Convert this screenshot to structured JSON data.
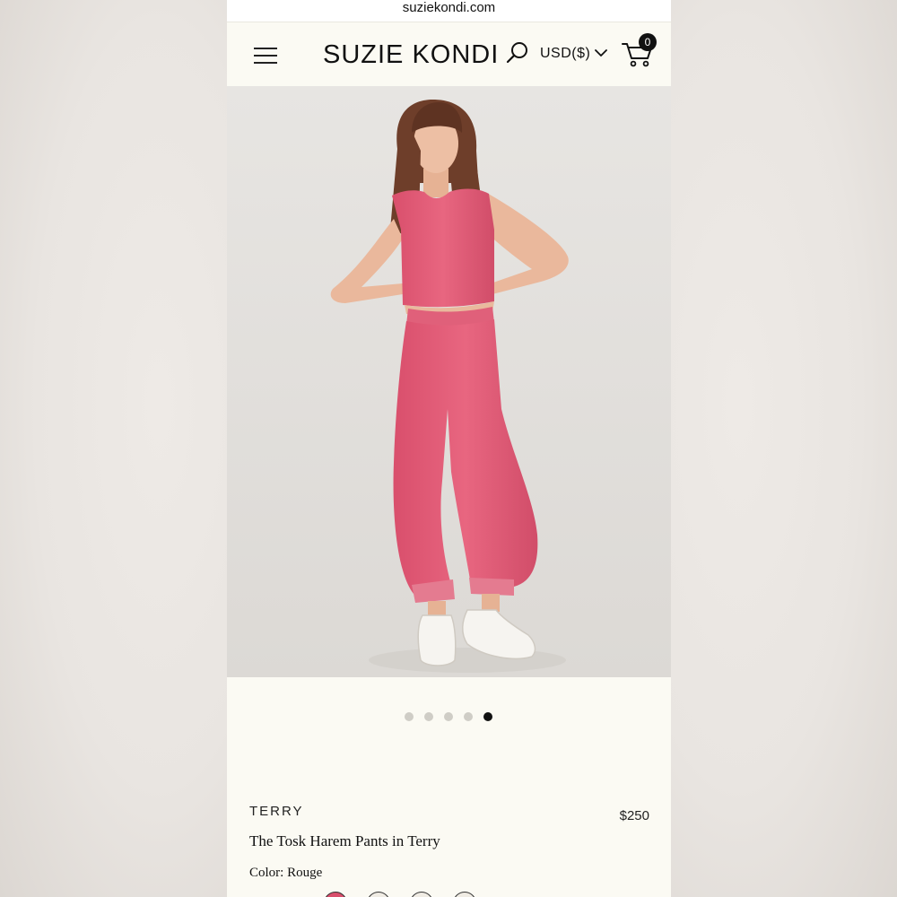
{
  "browser": {
    "url": "suziekondi.com"
  },
  "header": {
    "brand": "SUZIE KONDI",
    "currency": "USD($)",
    "cart_count": "0"
  },
  "carousel": {
    "total_slides": 5,
    "active_slide": 5
  },
  "product": {
    "category": "TERRY",
    "name": "The Tosk Harem Pants in Terry",
    "price": "$250",
    "color_label": "Color: Rouge",
    "swatch_count": 4
  },
  "icons": {
    "menu": "hamburger-menu-icon",
    "search": "search-icon",
    "currency_dropdown": "chevron-down-icon",
    "cart": "shopping-cart-icon"
  },
  "colors": {
    "page_bg": "#fbfaf3",
    "text": "#111111",
    "outfit": "#e15c77",
    "dot_inactive": "#cfcdc6",
    "dot_active": "#111111"
  }
}
